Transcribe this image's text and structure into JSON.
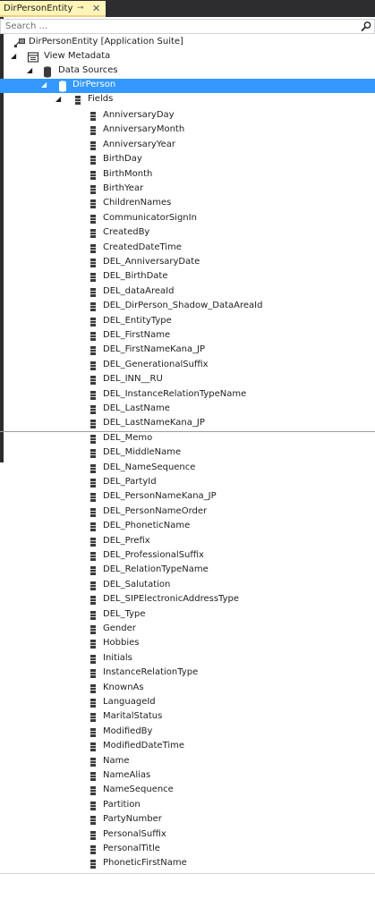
{
  "tab": {
    "title": "DirPersonEntity",
    "pin_glyph": "⊸",
    "close_glyph": "✕"
  },
  "search": {
    "placeholder": "Search ..."
  },
  "tree": {
    "root_label": "DirPersonEntity [Application Suite]",
    "view_metadata_label": "View Metadata",
    "data_sources_label": "Data Sources",
    "selected_node_label": "DirPerson",
    "fields_label": "Fields",
    "fields": [
      "AnniversaryDay",
      "AnniversaryMonth",
      "AnniversaryYear",
      "BirthDay",
      "BirthMonth",
      "BirthYear",
      "ChildrenNames",
      "CommunicatorSignIn",
      "CreatedBy",
      "CreatedDateTime",
      "DEL_AnniversaryDate",
      "DEL_BirthDate",
      "DEL_dataAreaId",
      "DEL_DirPerson_Shadow_DataAreaId",
      "DEL_EntityType",
      "DEL_FirstName",
      "DEL_FirstNameKana_JP",
      "DEL_GenerationalSuffix",
      "DEL_INN__RU",
      "DEL_InstanceRelationTypeName",
      "DEL_LastName",
      "DEL_LastNameKana_JP",
      "DEL_Memo",
      "DEL_MiddleName",
      "DEL_NameSequence",
      "DEL_PartyId",
      "DEL_PersonNameKana_JP",
      "DEL_PersonNameOrder",
      "DEL_PhoneticName",
      "DEL_Prefix",
      "DEL_ProfessionalSuffix",
      "DEL_RelationTypeName",
      "DEL_Salutation",
      "DEL_SIPElectronicAddressType",
      "DEL_Type",
      "Gender",
      "Hobbies",
      "Initials",
      "InstanceRelationType",
      "KnownAs",
      "LanguageId",
      "MaritalStatus",
      "ModifiedBy",
      "ModifiedDateTime",
      "Name",
      "NameAlias",
      "NameSequence",
      "Partition",
      "PartyNumber",
      "PersonalSuffix",
      "PersonalTitle",
      "PhoneticFirstName"
    ]
  },
  "colors": {
    "selection": "#3399ff",
    "tab_active": "#fff5b8",
    "frame": "#2d2d30"
  },
  "icons": {
    "field": "field-icon",
    "data_source": "database-icon",
    "view": "view-metadata-icon",
    "root": "entity-icon"
  }
}
